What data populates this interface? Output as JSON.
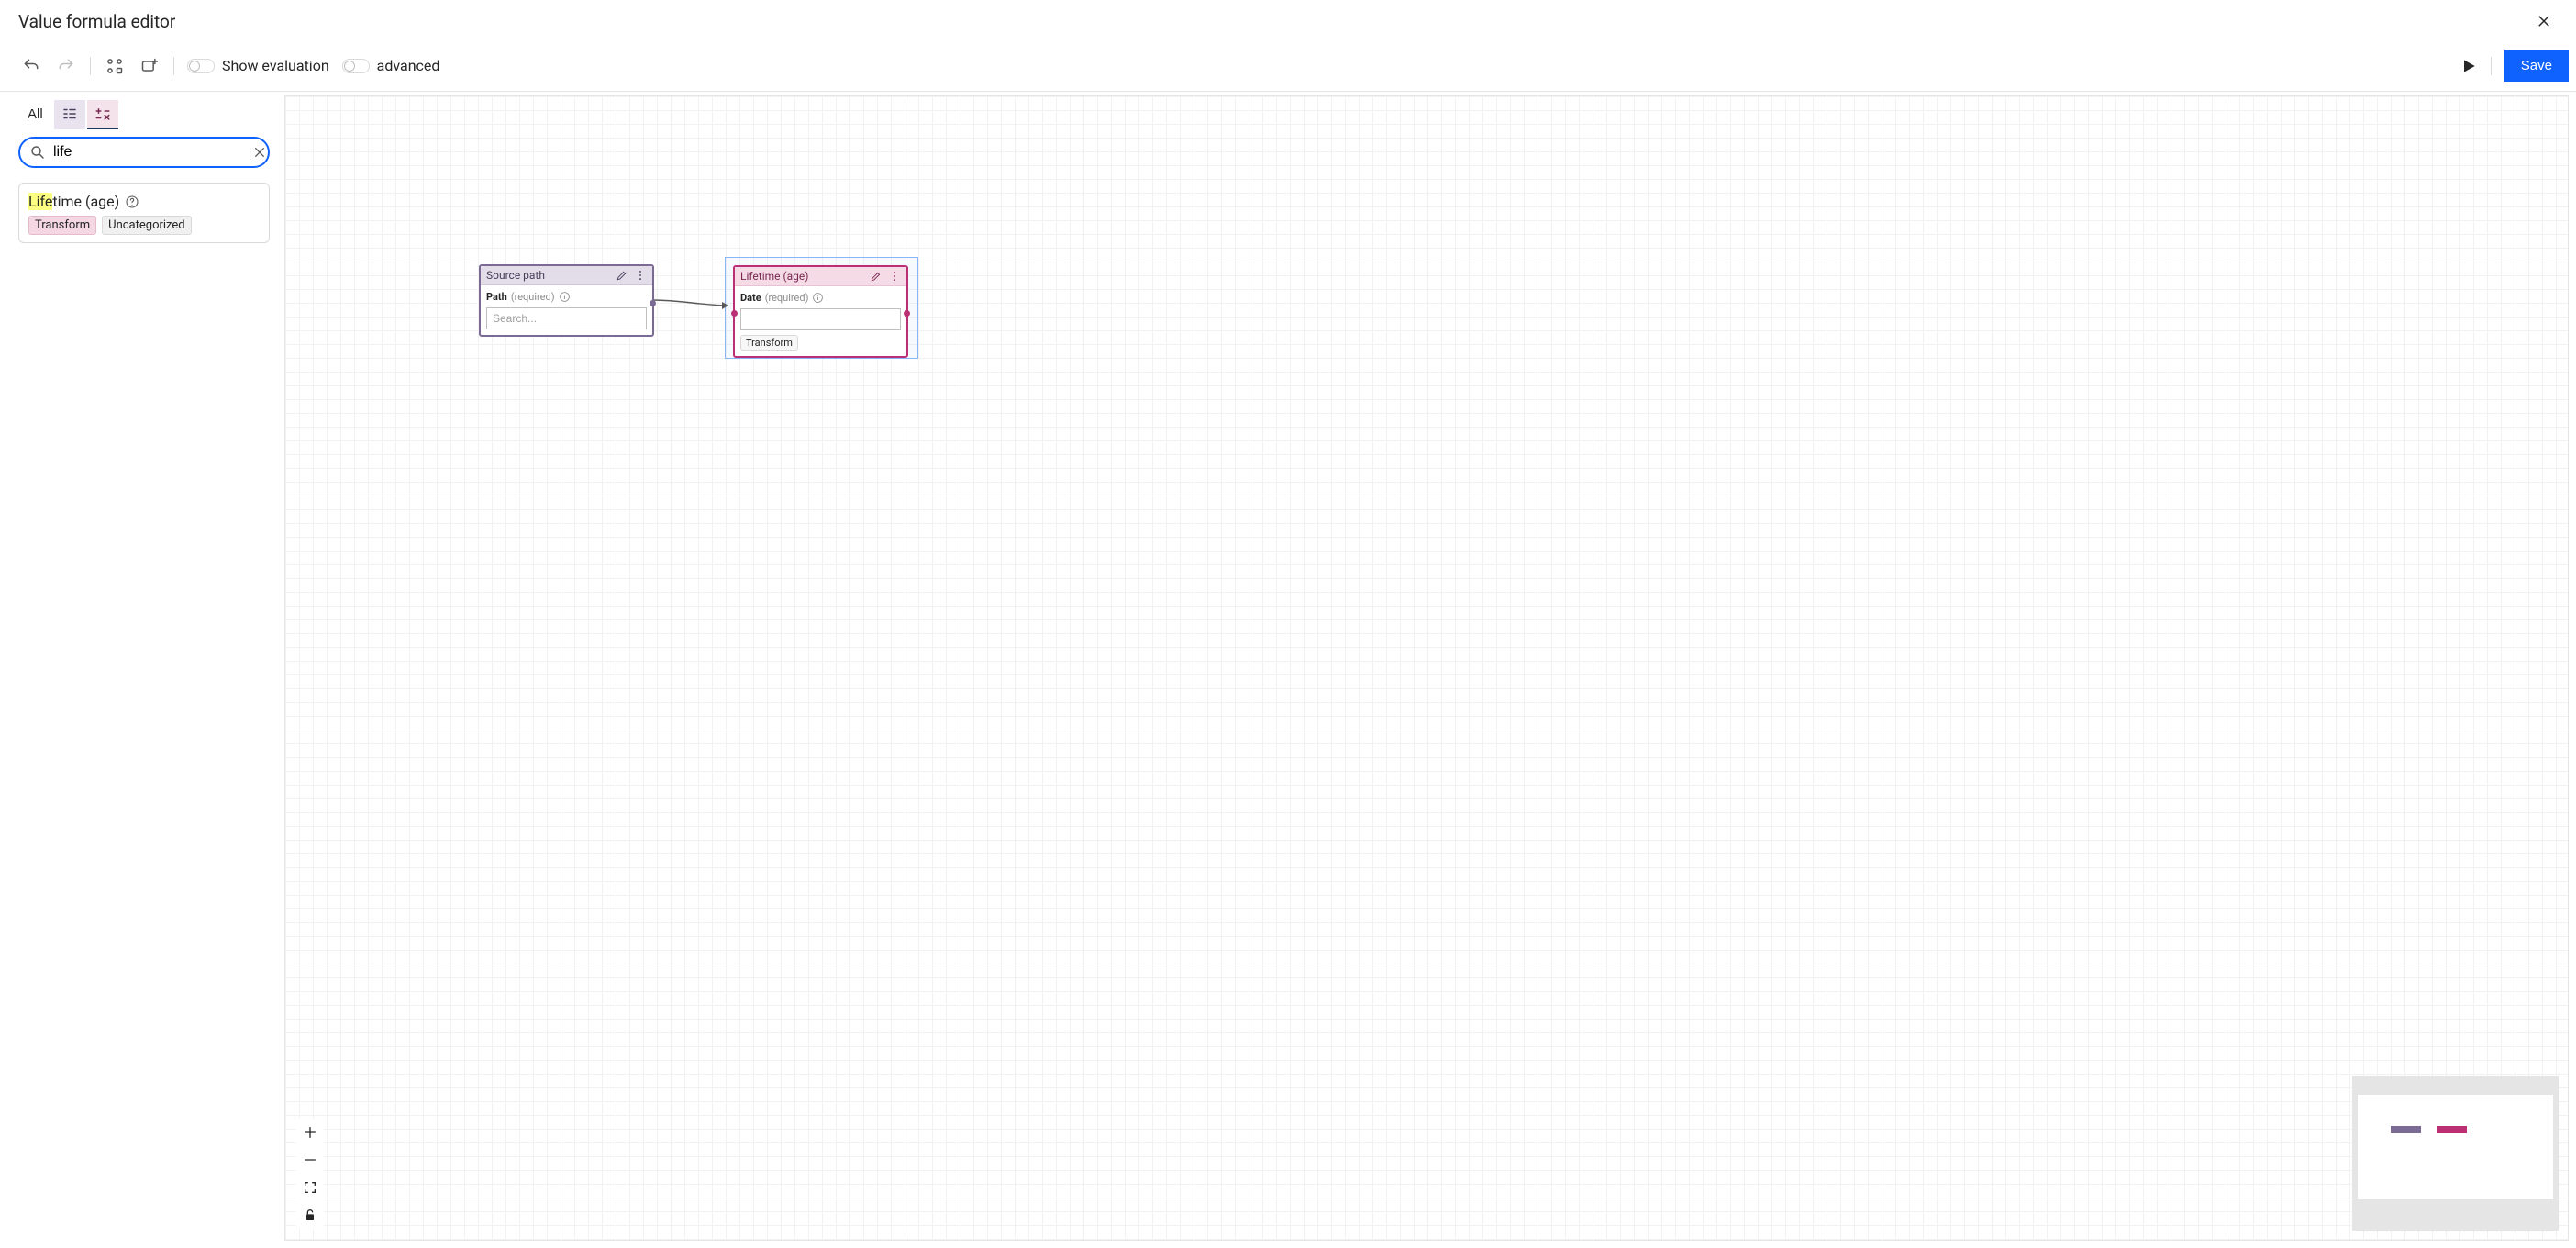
{
  "header": {
    "title": "Value formula editor"
  },
  "toolbar": {
    "show_eval_label": "Show evaluation",
    "advanced_label": "advanced",
    "save_label": "Save"
  },
  "sidebar": {
    "tab_all": "All",
    "search_value": "life",
    "search_placeholder": "",
    "result": {
      "highlight": "Life",
      "rest": "time (age)",
      "badge_transform": "Transform",
      "badge_uncat": "Uncategorized"
    }
  },
  "canvas": {
    "node1": {
      "title": "Source path",
      "field_label": "Path",
      "required": "(required)",
      "placeholder": "Search..."
    },
    "node2": {
      "title": "Lifetime (age)",
      "field_label": "Date",
      "required": "(required)",
      "badge": "Transform"
    }
  }
}
